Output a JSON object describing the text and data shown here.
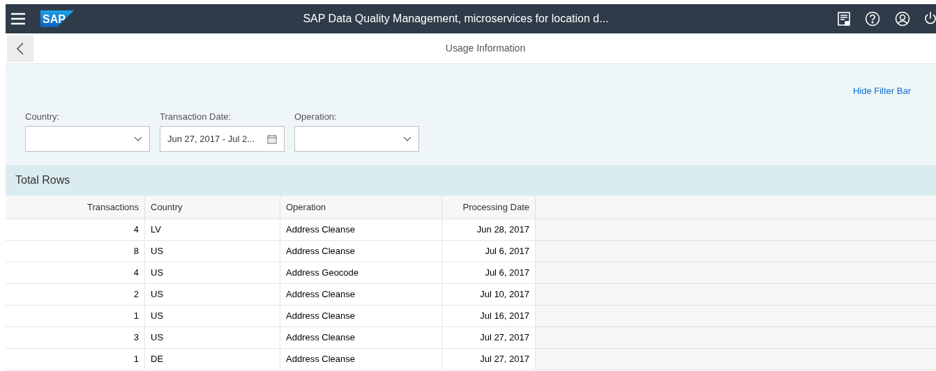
{
  "shell": {
    "logo": "SAP",
    "title": "SAP Data Quality Management, microservices for location d..."
  },
  "page": {
    "title": "Usage Information"
  },
  "filter_bar": {
    "toggle": "Hide Filter Bar",
    "filters": [
      {
        "label": "Country:",
        "kind": "select"
      },
      {
        "label": "Transaction Date:",
        "kind": "date",
        "value": "Jun 27, 2017 - Jul 2..."
      },
      {
        "label": "Operation:",
        "kind": "select"
      }
    ]
  },
  "table": {
    "title": "Total Rows",
    "columns": [
      {
        "label": "Transactions",
        "kind": "number"
      },
      {
        "label": "Country",
        "kind": "text"
      },
      {
        "label": "Operation",
        "kind": "text"
      },
      {
        "label": "Processing Date",
        "kind": "date"
      }
    ],
    "rows": [
      [
        "4",
        "LV",
        "Address Cleanse",
        "Jun 28, 2017"
      ],
      [
        "8",
        "US",
        "Address Cleanse",
        "Jul 6, 2017"
      ],
      [
        "4",
        "US",
        "Address Geocode",
        "Jul 6, 2017"
      ],
      [
        "2",
        "US",
        "Address Cleanse",
        "Jul 10, 2017"
      ],
      [
        "1",
        "US",
        "Address Cleanse",
        "Jul 16, 2017"
      ],
      [
        "3",
        "US",
        "Address Cleanse",
        "Jul 27, 2017"
      ],
      [
        "1",
        "DE",
        "Address Cleanse",
        "Jul 27, 2017"
      ]
    ]
  }
}
